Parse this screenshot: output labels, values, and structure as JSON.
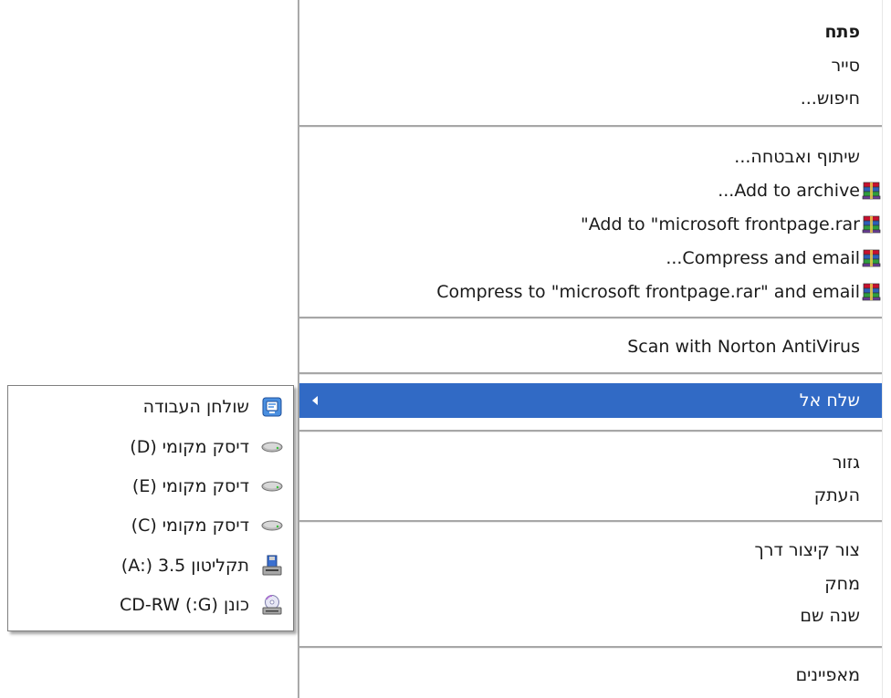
{
  "main_menu": {
    "open": "פתח",
    "explore": "סייר",
    "search": "חיפוש...",
    "sharing_security": "שיתוף ואבטחה...",
    "add_to_archive": "...Add to archive",
    "add_to_rar": "\"Add to \"microsoft frontpage.rar",
    "compress_email": "...Compress and email",
    "compress_to_rar_email": "Compress to \"microsoft frontpage.rar\" and email",
    "scan_norton": "Scan with Norton AntiVirus",
    "send_to": "שלח אל",
    "cut": "גזור",
    "copy": "העתק",
    "create_shortcut": "צור קיצור דרך",
    "delete": "מחק",
    "rename": "שנה שם",
    "properties": "מאפיינים"
  },
  "send_to_menu": {
    "desktop": "שולחן העבודה",
    "disk_d": "דיסק מקומי (D)",
    "disk_e": "דיסק מקומי (E)",
    "disk_c": "דיסק מקומי (C)",
    "floppy": "תקליטון 3.5 (:A)",
    "cdrw": "כונן CD-RW (:G)"
  },
  "colors": {
    "highlight": "#316ac5",
    "separator": "#a7a7a7"
  },
  "icons": {
    "winrar": "winrar-icon",
    "desktop": "desktop-icon",
    "disk": "hard-disk-icon",
    "floppy": "floppy-drive-icon",
    "cd": "cd-drive-icon"
  }
}
